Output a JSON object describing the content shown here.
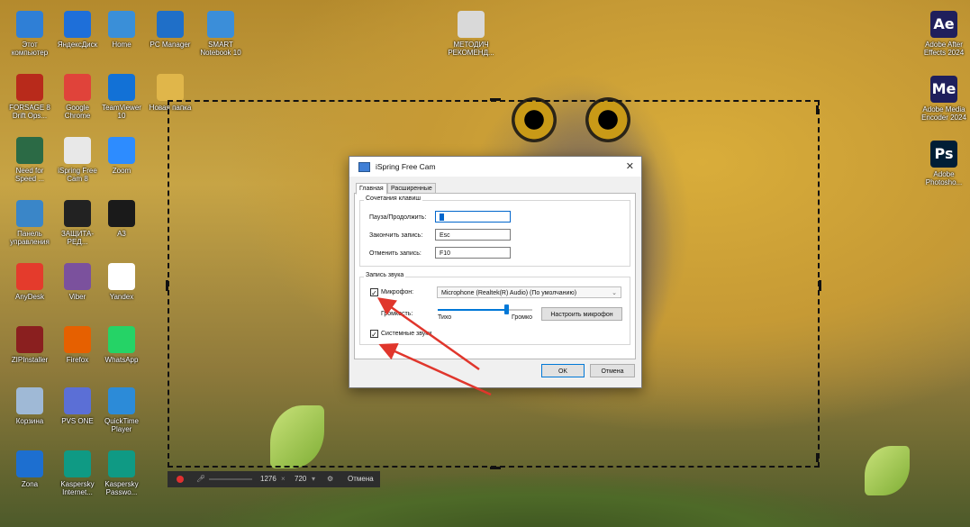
{
  "desktop": {
    "left_icons": [
      {
        "label": "Этот компьютер",
        "icon": "computer-icon",
        "color": "#2f7fd6"
      },
      {
        "label": "ЯндексДиск",
        "icon": "yandex-disk-icon",
        "color": "#1e6fd9"
      },
      {
        "label": "Home",
        "icon": "folder-icon",
        "color": "#3a8fd8"
      },
      {
        "label": "PC Manager",
        "icon": "pc-manager-icon",
        "color": "#1f6fc8"
      },
      {
        "label": "SMART Notebook 10",
        "icon": "smart-notebook-icon",
        "color": "#3b8ed9"
      },
      {
        "label": "FORSAGE 8 Drift Ops...",
        "icon": "game-icon",
        "color": "#b82a1b"
      },
      {
        "label": "Google Chrome",
        "icon": "chrome-icon",
        "color": "#e0433a"
      },
      {
        "label": "TeamViewer 10",
        "icon": "teamviewer-icon",
        "color": "#1271d6"
      },
      {
        "label": "Новая папка",
        "icon": "folder-icon",
        "color": "#e0b64a"
      },
      {
        "label": "Need for Speed ...",
        "icon": "nfs-icon",
        "color": "#2b6a45"
      },
      {
        "label": "iSpring Free Cam 8",
        "icon": "ispring-icon",
        "color": "#e8e8e8"
      },
      {
        "label": "Zoom",
        "icon": "zoom-icon",
        "color": "#2d8cff"
      },
      {
        "label": "Панель управления",
        "icon": "control-panel-icon",
        "color": "#3a86c8"
      },
      {
        "label": "ЗАЩИТА-РЕД...",
        "icon": "book-icon",
        "color": "#222222"
      },
      {
        "label": "A3",
        "icon": "book-icon",
        "color": "#1a1a1a"
      },
      {
        "label": "AnyDesk",
        "icon": "anydesk-icon",
        "color": "#e43b2c"
      },
      {
        "label": "Viber",
        "icon": "viber-icon",
        "color": "#7b519d"
      },
      {
        "label": "Yandex",
        "icon": "yandex-icon",
        "color": "#ffffff"
      },
      {
        "label": "ZIPInstaller",
        "icon": "zip-icon",
        "color": "#8a1f1f"
      },
      {
        "label": "Firefox",
        "icon": "firefox-icon",
        "color": "#e66000"
      },
      {
        "label": "WhatsApp",
        "icon": "whatsapp-icon",
        "color": "#25d366"
      },
      {
        "label": "Корзина",
        "icon": "recycle-bin-icon",
        "color": "#9fb9d6"
      },
      {
        "label": "PVS ONE",
        "icon": "pvs-icon",
        "color": "#5b6fd6"
      },
      {
        "label": "QuickTime Player",
        "icon": "quicktime-icon",
        "color": "#2c8bd8"
      },
      {
        "label": "Zona",
        "icon": "zona-icon",
        "color": "#1d6fd0"
      },
      {
        "label": "Kaspersky Internet...",
        "icon": "kaspersky-icon",
        "color": "#0f9a84"
      },
      {
        "label": "Kaspersky Passwo...",
        "icon": "kaspersky-password-icon",
        "color": "#0f9a84"
      }
    ],
    "mid_icon": {
      "label": "МЕТОДИЧ РЕКОМЕНД...",
      "icon": "document-icon",
      "color": "#d9d9d9"
    },
    "right_icons": [
      {
        "label": "Adobe After Effects 2024",
        "letters": "Ae",
        "icon": "after-effects-icon",
        "color": "#1f1f5c"
      },
      {
        "label": "Adobe Media Encoder 2024",
        "letters": "Me",
        "icon": "media-encoder-icon",
        "color": "#1f1f5c"
      },
      {
        "label": "Adobe Photosho...",
        "letters": "Ps",
        "icon": "photoshop-icon",
        "color": "#001e36"
      }
    ]
  },
  "dialog": {
    "title": "iSpring Free Cam",
    "close_glyph": "✕",
    "tabs": [
      "Главная",
      "Расширенные"
    ],
    "hotkeys": {
      "group_label": "Сочетания клавиш",
      "rows": [
        {
          "label": "Пауза/Продолжить:",
          "value": ""
        },
        {
          "label": "Закончить запись:",
          "value": "Esc"
        },
        {
          "label": "Отменить запись:",
          "value": "F10"
        }
      ]
    },
    "audio": {
      "group_label": "Запись звука",
      "mic_label": "Микрофон:",
      "mic_checked": true,
      "mic_device": "Microphone (Realtek(R) Audio) (По умолчанию)",
      "volume_label": "Громкость:",
      "volume_min": "Тихо",
      "volume_max": "Громко",
      "volume_level": 0.72,
      "configure_button": "Настроить микрофон",
      "system_sounds_label": "Системные звуки",
      "system_sounds_checked": true,
      "check_glyph": "✓"
    },
    "ok_button": "OK",
    "cancel_button": "Отмена"
  },
  "recorder": {
    "width": "1276",
    "times": "×",
    "height": "720",
    "dropdown_glyph": "▾",
    "cancel": "Отмена"
  },
  "colors": {
    "accent": "#0078d7",
    "annotation": "#e0362c"
  }
}
